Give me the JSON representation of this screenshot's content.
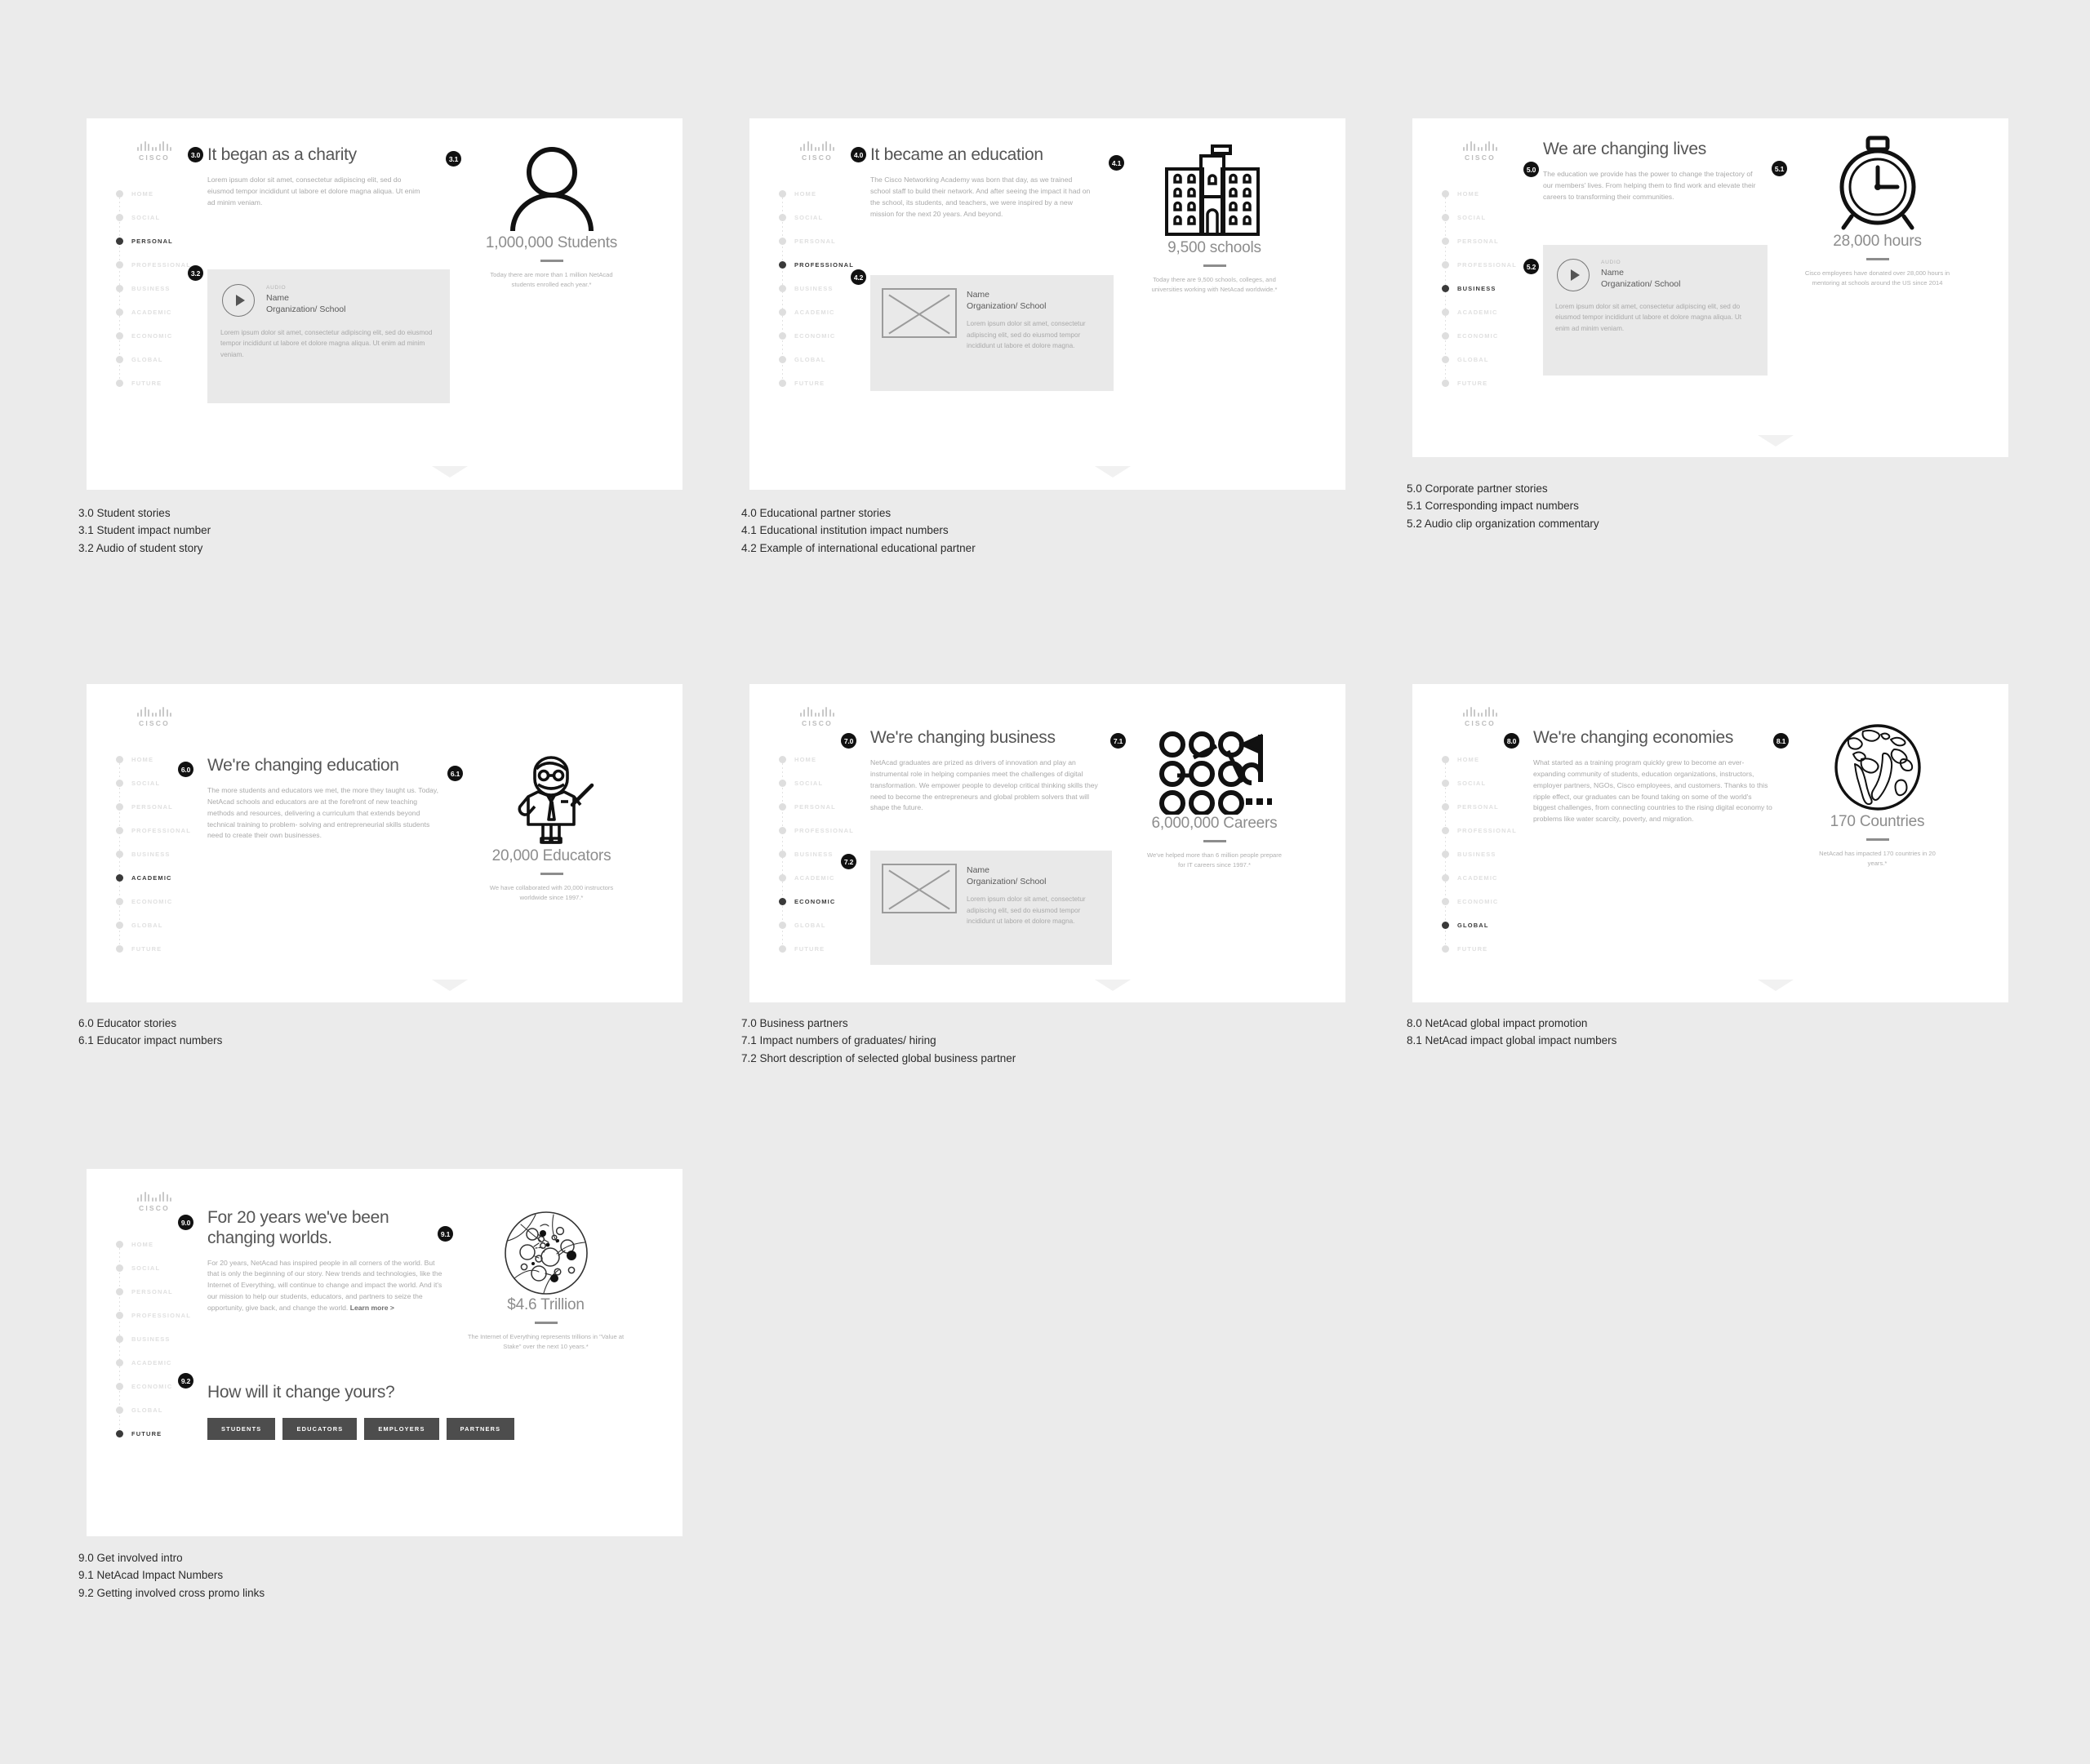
{
  "brand": {
    "logo_word": "CISCO"
  },
  "nav_items": [
    "HOME",
    "SOCIAL",
    "PERSONAL",
    "PROFESSIONAL",
    "BUSINESS",
    "ACADEMIC",
    "ECONOMIC",
    "GLOBAL",
    "FUTURE"
  ],
  "audio_kicker": "AUDIO",
  "media_name": "Name",
  "media_org": "Organization/ School",
  "cards": [
    {
      "id": "card-3",
      "active_nav": "PERSONAL",
      "badge_title": "3.0",
      "badge_stat": "3.1",
      "badge_panel": "3.2",
      "title": "It began as a charity",
      "body": "Lorem ipsum dolor sit amet, consectetur adipiscing elit, sed do eiusmod tempor incididunt ut labore et dolore magna aliqua. Ut enim ad minim veniam.",
      "panel_copy": "Lorem ipsum dolor sit amet, consectetur adipiscing elit, sed do eiusmod tempor incididunt ut labore et dolore magna aliqua. Ut enim ad minim veniam.",
      "stat_number": "1,000,000 Students",
      "stat_caption": "Today there are more than 1 million NetAcad students enrolled each year.*",
      "caption": "3.0 Student stories\n3.1 Student impact number\n3.2 Audio of student story"
    },
    {
      "id": "card-4",
      "active_nav": "PROFESSIONAL",
      "badge_title": "4.0",
      "badge_stat": "4.1",
      "badge_panel": "4.2",
      "title": "It became an education",
      "body": "The Cisco Networking Academy was born that day, as we trained school staff to build their network. And after seeing the impact it had on the school, its students, and teachers, we were inspired by a new mission for the next 20 years. And beyond.",
      "panel_copy": "Lorem ipsum dolor sit amet, consectetur adipiscing elit, sed do eiusmod tempor incididunt ut labore et dolore magna.",
      "stat_number": "9,500 schools",
      "stat_caption": "Today there are 9,500 schools, colleges, and universities working with NetAcad worldwide.*",
      "caption": "4.0 Educational partner stories\n4.1 Educational institution impact numbers\n4.2 Example of international educational partner"
    },
    {
      "id": "card-5",
      "active_nav": "BUSINESS",
      "badge_title": "5.0",
      "badge_stat": "5.1",
      "badge_panel": "5.2",
      "title": "We are changing lives",
      "body": "The education we provide has the power to change the trajectory of our members' lives. From helping them to find work and elevate their careers to transforming their communities.",
      "panel_copy": "Lorem ipsum dolor sit amet, consectetur adipiscing elit, sed do eiusmod tempor incididunt ut labore et dolore magna aliqua. Ut enim ad minim veniam.",
      "stat_number": "28,000 hours",
      "stat_caption": "Cisco employees have donated over 28,000 hours in mentoring at schools around the US since 2014",
      "caption": "5.0 Corporate partner stories\n5.1 Corresponding impact numbers\n5.2 Audio clip organization commentary"
    },
    {
      "id": "card-6",
      "active_nav": "ACADEMIC",
      "badge_title": "6.0",
      "badge_stat": "6.1",
      "title": "We're changing education",
      "body": "The more students and educators we met, the more they taught us. Today, NetAcad schools and educators are at the forefront of new teaching methods and resources, delivering a curriculum that extends beyond technical training to problem- solving and entrepreneurial skills students need to create their own businesses.",
      "stat_number": "20,000 Educators",
      "stat_caption": "We have collaborated with 20,000 instructors worldwide since 1997.*",
      "caption": "6.0 Educator stories\n6.1 Educator impact numbers"
    },
    {
      "id": "card-7",
      "active_nav": "ECONOMIC",
      "badge_title": "7.0",
      "badge_stat": "7.1",
      "badge_panel": "7.2",
      "title": "We're changing business",
      "body": "NetAcad graduates are prized as drivers of innovation and play an instrumental role in helping companies meet the challenges of digital transformation. We empower people to develop critical thinking skills they need to become the entrepreneurs and global problem solvers that will shape the future.",
      "panel_copy": "Lorem ipsum dolor sit amet, consectetur adipiscing elit, sed do eiusmod tempor incididunt ut labore et dolore magna.",
      "stat_number": "6,000,000 Careers",
      "stat_caption": "We've helped more than 6 million people prepare for IT careers since 1997.*",
      "caption": "7.0 Business partners\n7.1 Impact numbers of graduates/ hiring\n7.2 Short description of selected global business partner"
    },
    {
      "id": "card-8",
      "active_nav": "GLOBAL",
      "badge_title": "8.0",
      "badge_stat": "8.1",
      "title": "We're changing economies",
      "body": "What started as a training program quickly grew to become an ever-expanding community of students, education organizations, instructors, employer partners, NGOs, Cisco employees, and customers. Thanks to this ripple effect, our graduates can be found taking on some of the world's biggest challenges, from connecting countries to the rising digital economy to problems like water scarcity, poverty, and migration.",
      "stat_number": "170 Countries",
      "stat_caption": "NetAcad has impacted 170 countries in 20 years.*",
      "caption": "8.0 NetAcad global impact promotion\n8.1 NetAcad impact global impact numbers"
    },
    {
      "id": "card-9",
      "active_nav": "FUTURE",
      "badge_title": "9.0",
      "badge_stat": "9.1",
      "badge_panel": "9.2",
      "title": "For 20 years we've been changing worlds.",
      "body": "For 20 years, NetAcad has inspired people in all corners of the world. But that is only the beginning of our story. New trends and technologies, like the Internet of Everything, will continue to change and impact the world. And it's our mission to help our students, educators, and partners to seize the opportunity, give back, and change the world. ",
      "body_link": "Learn more >",
      "subheading": "How will it change yours?",
      "buttons": [
        "STUDENTS",
        "EDUCATORS",
        "EMPLOYERS",
        "PARTNERS"
      ],
      "stat_number": "$4.6 Trillion",
      "stat_caption": "The Internet of Everything represents trillions in \"Value at Stake\" over the next 10 years.*",
      "caption": "9.0 Get involved intro\n9.1 NetAcad  Impact Numbers\n9.2 Getting involved cross promo links"
    }
  ]
}
